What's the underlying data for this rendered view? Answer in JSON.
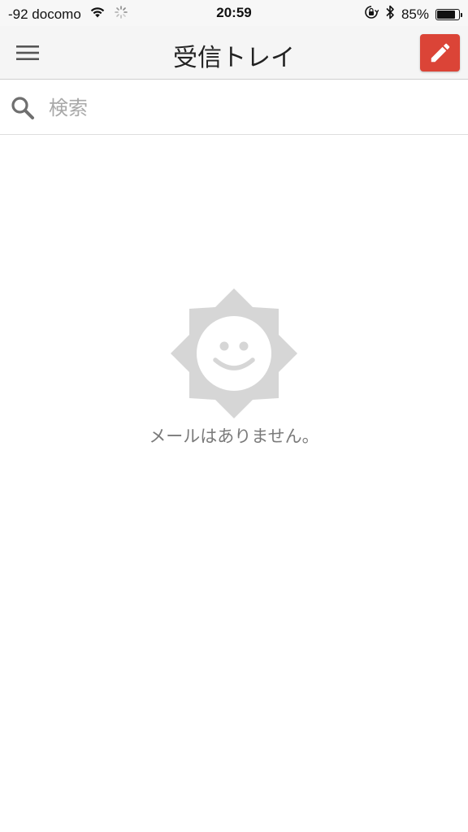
{
  "status_bar": {
    "carrier": "-92 docomo",
    "time": "20:59",
    "battery_percent_label": "85%",
    "battery_level": 0.85
  },
  "header": {
    "title": "受信トレイ",
    "menu_icon": "hamburger-menu-icon",
    "compose_icon": "pencil-icon",
    "accent_color": "#db4437"
  },
  "search": {
    "placeholder": "検索",
    "value": ""
  },
  "empty_state": {
    "message": "メールはありません。",
    "illustration": "smiling-sun-icon"
  }
}
